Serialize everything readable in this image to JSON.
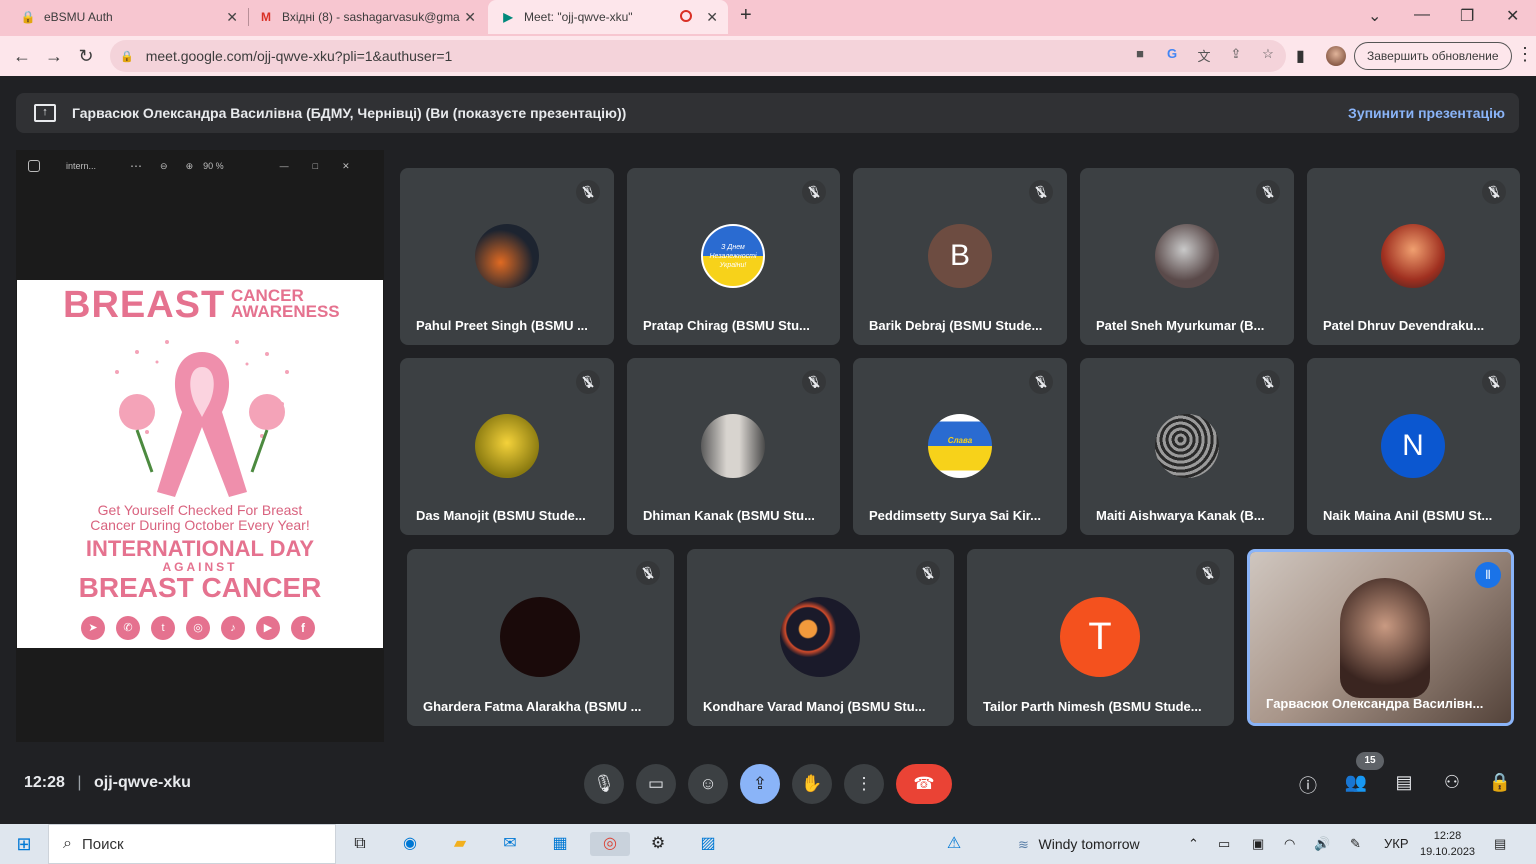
{
  "browser": {
    "tabs": [
      {
        "title": "eBSMU Auth"
      },
      {
        "title": "Вхідні (8) - sashagarvasuk@gma"
      },
      {
        "title": "Meet: \"ojj-qwve-xku\""
      }
    ],
    "url": "meet.google.com/ojj-qwve-xku?pli=1&authuser=1",
    "update_label": "Завершить обновление"
  },
  "meet": {
    "presenting_text": "Гарвасюк Олександра Василівна (БДМУ, Чернівці) (Ви (показуєте презентацію))",
    "stop_label": "Зупинити презентацію",
    "shared_window": {
      "title": "intern...",
      "zoom": "90 %"
    },
    "poster": {
      "title_big": "BREAST",
      "title_small_1": "CANCER",
      "title_small_2": "AWARENESS",
      "line1": "Get Yourself Checked For Breast",
      "line2": "Cancer During October Every Year!",
      "line3": "INTERNATIONAL DAY",
      "line4": "AGAINST",
      "line5": "BREAST CANCER"
    },
    "participants": [
      {
        "name": "Pahul Preet Singh (BSMU ...",
        "initial": ""
      },
      {
        "name": "Pratap Chirag (BSMU Stu...",
        "initial": ""
      },
      {
        "name": "Barik Debraj (BSMU Stude...",
        "initial": "B"
      },
      {
        "name": "Patel Sneh Myurkumar (B...",
        "initial": ""
      },
      {
        "name": "Patel Dhruv Devendraku...",
        "initial": ""
      },
      {
        "name": "Das Manojit (BSMU Stude...",
        "initial": ""
      },
      {
        "name": "Dhiman Kanak (BSMU Stu...",
        "initial": ""
      },
      {
        "name": "Peddimsetty Surya Sai Kir...",
        "initial": ""
      },
      {
        "name": "Maiti Aishwarya Kanak (B...",
        "initial": ""
      },
      {
        "name": "Naik Maina Anil (BSMU St...",
        "initial": "N"
      },
      {
        "name": "Ghardera Fatma Alarakha (BSMU ...",
        "initial": ""
      },
      {
        "name": "Kondhare Varad Manoj (BSMU Stu...",
        "initial": ""
      },
      {
        "name": "Tailor Parth Nimesh (BSMU Stude...",
        "initial": "T"
      },
      {
        "name": "Гарвасюк Олександра Василівн...",
        "initial": ""
      }
    ],
    "avatar_texts": {
      "pratap": "З Днем Незалежності України!",
      "peddimsetty": "Слава Україні"
    },
    "time": "12:28",
    "meeting_code": "ojj-qwve-xku",
    "people_count": "15"
  },
  "taskbar": {
    "search_placeholder": "Поиск",
    "weather": "Windy tomorrow",
    "lang": "УКР",
    "time": "12:28",
    "date": "19.10.2023"
  },
  "colors": {
    "accent": "#8ab4f8",
    "end_call": "#ea4335",
    "tab_bg": "#f7c6d0"
  }
}
